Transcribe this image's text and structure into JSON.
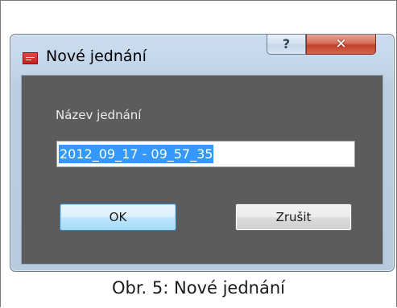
{
  "window": {
    "title": "Nové jednání",
    "help_glyph": "?",
    "close_glyph": "✕",
    "app_icon": "app-logo-icon"
  },
  "form": {
    "label": "Název jednání",
    "input_value": "2012_09_17 - 09_57_35"
  },
  "buttons": {
    "ok_label": "OK",
    "cancel_label": "Zrušit"
  },
  "caption": "Obr. 5: Nové jednání",
  "colors": {
    "client_bg": "#5c5c5c",
    "selection": "#3399ff",
    "close_button": "#c3402a",
    "frame": "#b9cde3"
  }
}
